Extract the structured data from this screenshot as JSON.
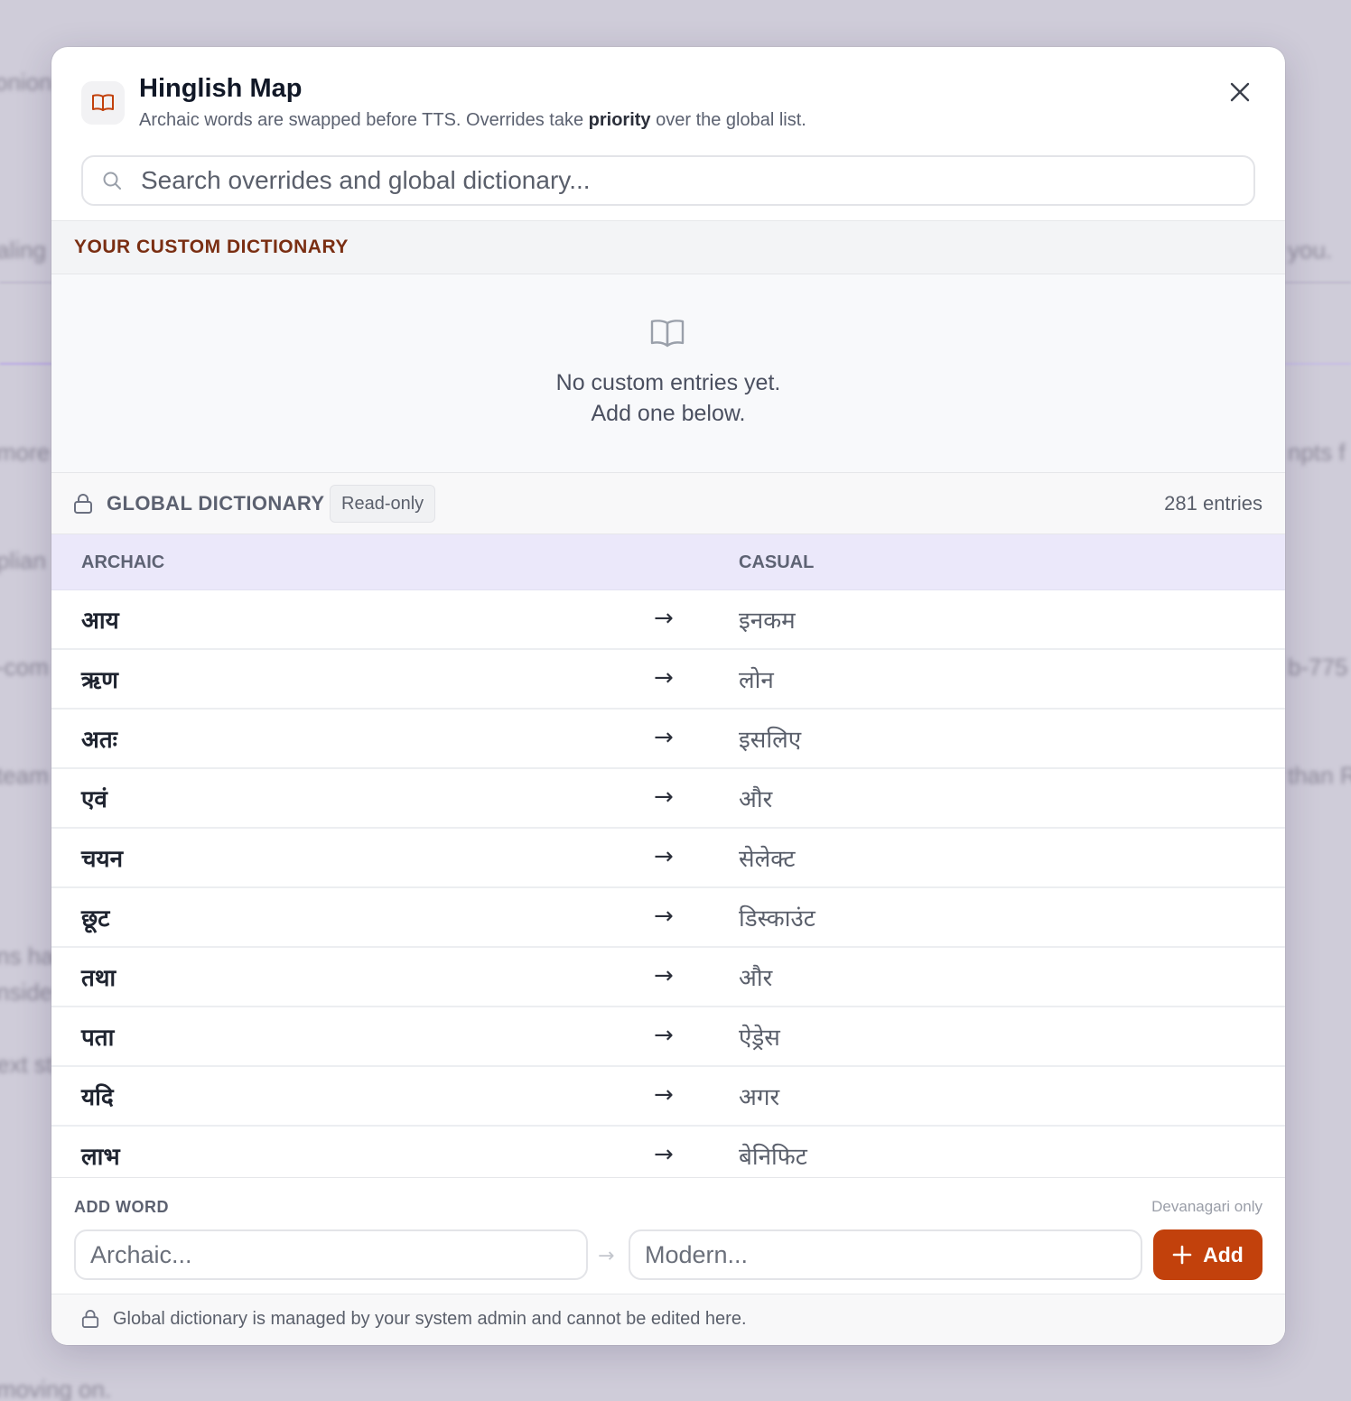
{
  "dialog": {
    "title": "Hinglish Map",
    "subtitle_pre": "Archaic words are swapped before TTS. Overrides take ",
    "subtitle_bold": "priority",
    "subtitle_post": " over the global list.",
    "icon": "book-icon",
    "close_icon": "close-icon"
  },
  "search": {
    "placeholder": "Search overrides and global dictionary...",
    "value": "",
    "icon": "search-icon"
  },
  "custom_dictionary": {
    "heading": "YOUR CUSTOM DICTIONARY",
    "empty_line1": "No custom entries yet.",
    "empty_line2": "Add one below.",
    "empty_icon": "book-open-icon",
    "accent_color": "#7a2e12"
  },
  "global_dictionary": {
    "heading": "GLOBAL DICTIONARY",
    "badge": "Read-only",
    "count": "281 entries",
    "lock_icon": "lock-icon",
    "columns": {
      "archaic": "ARCHAIC",
      "casual": "CASUAL"
    },
    "arrow": "→",
    "rows": [
      {
        "archaic": "आय",
        "casual": "इनकम"
      },
      {
        "archaic": "ऋण",
        "casual": "लोन"
      },
      {
        "archaic": "अतः",
        "casual": "इसलिए"
      },
      {
        "archaic": "एवं",
        "casual": "और"
      },
      {
        "archaic": "चयन",
        "casual": "सेलेक्ट"
      },
      {
        "archaic": "छूट",
        "casual": "डिस्काउंट"
      },
      {
        "archaic": "तथा",
        "casual": "और"
      },
      {
        "archaic": "पता",
        "casual": "ऐड्रेस"
      },
      {
        "archaic": "यदि",
        "casual": "अगर"
      },
      {
        "archaic": "लाभ",
        "casual": "बेनिफिट"
      }
    ]
  },
  "add_word": {
    "label": "ADD WORD",
    "hint": "Devanagari only",
    "archaic_placeholder": "Archaic...",
    "modern_placeholder": "Modern...",
    "arrow": "→",
    "button_label": "Add",
    "button_color": "#c2410c"
  },
  "footer": {
    "text": "Global dictionary is managed by your system admin and cannot be edited here."
  }
}
